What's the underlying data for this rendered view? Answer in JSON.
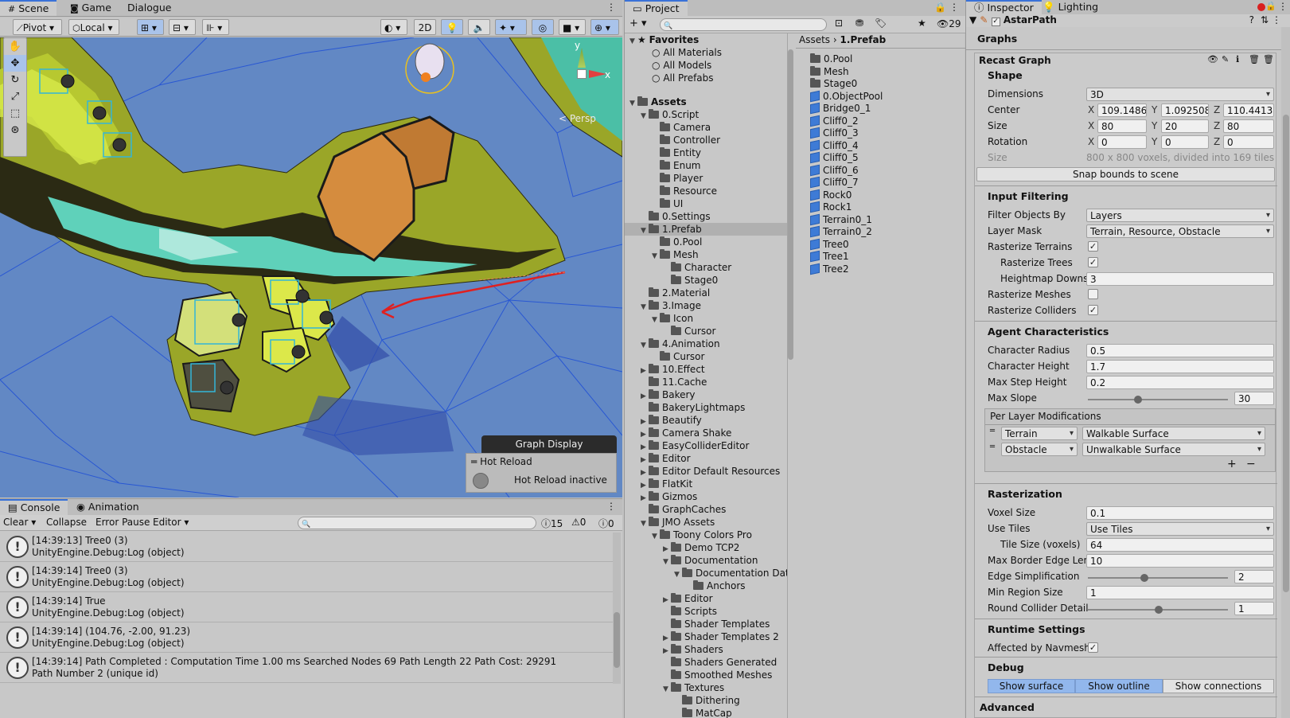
{
  "scene_tabs": [
    "Scene",
    "Game",
    "Dialogue"
  ],
  "scene_toolbar": {
    "pivot": "Pivot",
    "local": "Local",
    "mode2d": "2D"
  },
  "persp": "< Persp",
  "axis_labels": {
    "y": "y",
    "x": "x",
    "z": "z"
  },
  "overlay": {
    "graph_display": "Graph Display",
    "hot_reload": "Hot Reload",
    "hot_reload_status": "Hot Reload inactive"
  },
  "console": {
    "tabs": [
      "Console",
      "Animation"
    ],
    "clear": "Clear",
    "collapse": "Collapse",
    "error_pause": "Error Pause",
    "editor": "Editor",
    "count_log": "15",
    "count_warn": "0",
    "count_err": "0",
    "logs": [
      {
        "l1": "[14:39:13] Tree0 (3)",
        "l2": "UnityEngine.Debug:Log (object)"
      },
      {
        "l1": "[14:39:14] Tree0 (3)",
        "l2": "UnityEngine.Debug:Log (object)"
      },
      {
        "l1": "[14:39:14] True",
        "l2": "UnityEngine.Debug:Log (object)"
      },
      {
        "l1": "[14:39:14] (104.76, -2.00, 91.23)",
        "l2": "UnityEngine.Debug:Log (object)"
      },
      {
        "l1": "[14:39:14] Path Completed : Computation Time 1.00 ms Searched Nodes 69 Path Length 22 Path Cost: 29291",
        "l2": "Path Number 2 (unique id)"
      }
    ]
  },
  "project": {
    "tab": "Project",
    "hidden_count": "29",
    "favorites": "Favorites",
    "fav_items": [
      "All Materials",
      "All Models",
      "All Prefabs"
    ],
    "assets": "Assets",
    "tree": [
      {
        "d": 1,
        "a": "▼",
        "t": "0.Script"
      },
      {
        "d": 2,
        "a": "",
        "t": "Camera"
      },
      {
        "d": 2,
        "a": "",
        "t": "Controller"
      },
      {
        "d": 2,
        "a": "",
        "t": "Entity"
      },
      {
        "d": 2,
        "a": "",
        "t": "Enum"
      },
      {
        "d": 2,
        "a": "",
        "t": "Player"
      },
      {
        "d": 2,
        "a": "",
        "t": "Resource"
      },
      {
        "d": 2,
        "a": "",
        "t": "UI"
      },
      {
        "d": 1,
        "a": "",
        "t": "0.Settings"
      },
      {
        "d": 1,
        "a": "▼",
        "t": "1.Prefab",
        "sel": true
      },
      {
        "d": 2,
        "a": "",
        "t": "0.Pool"
      },
      {
        "d": 2,
        "a": "▼",
        "t": "Mesh"
      },
      {
        "d": 3,
        "a": "",
        "t": "Character"
      },
      {
        "d": 3,
        "a": "",
        "t": "Stage0"
      },
      {
        "d": 1,
        "a": "",
        "t": "2.Material"
      },
      {
        "d": 1,
        "a": "▼",
        "t": "3.Image"
      },
      {
        "d": 2,
        "a": "▼",
        "t": "Icon"
      },
      {
        "d": 3,
        "a": "",
        "t": "Cursor"
      },
      {
        "d": 1,
        "a": "▼",
        "t": "4.Animation"
      },
      {
        "d": 2,
        "a": "",
        "t": "Cursor"
      },
      {
        "d": 1,
        "a": "▶",
        "t": "10.Effect"
      },
      {
        "d": 1,
        "a": "",
        "t": "11.Cache"
      },
      {
        "d": 1,
        "a": "▶",
        "t": "Bakery"
      },
      {
        "d": 1,
        "a": "",
        "t": "BakeryLightmaps"
      },
      {
        "d": 1,
        "a": "▶",
        "t": "Beautify"
      },
      {
        "d": 1,
        "a": "▶",
        "t": "Camera Shake"
      },
      {
        "d": 1,
        "a": "▶",
        "t": "EasyColliderEditor"
      },
      {
        "d": 1,
        "a": "▶",
        "t": "Editor"
      },
      {
        "d": 1,
        "a": "▶",
        "t": "Editor Default Resources"
      },
      {
        "d": 1,
        "a": "▶",
        "t": "FlatKit"
      },
      {
        "d": 1,
        "a": "▶",
        "t": "Gizmos"
      },
      {
        "d": 1,
        "a": "",
        "t": "GraphCaches"
      },
      {
        "d": 1,
        "a": "▼",
        "t": "JMO Assets"
      },
      {
        "d": 2,
        "a": "▼",
        "t": "Toony Colors Pro"
      },
      {
        "d": 3,
        "a": "▶",
        "t": "Demo TCP2"
      },
      {
        "d": 3,
        "a": "▼",
        "t": "Documentation"
      },
      {
        "d": 4,
        "a": "▼",
        "t": "Documentation Dat"
      },
      {
        "d": 5,
        "a": "",
        "t": "Anchors"
      },
      {
        "d": 3,
        "a": "▶",
        "t": "Editor"
      },
      {
        "d": 3,
        "a": "",
        "t": "Scripts"
      },
      {
        "d": 3,
        "a": "",
        "t": "Shader Templates"
      },
      {
        "d": 3,
        "a": "▶",
        "t": "Shader Templates 2"
      },
      {
        "d": 3,
        "a": "▶",
        "t": "Shaders"
      },
      {
        "d": 3,
        "a": "",
        "t": "Shaders Generated"
      },
      {
        "d": 3,
        "a": "",
        "t": "Smoothed Meshes"
      },
      {
        "d": 3,
        "a": "▼",
        "t": "Textures"
      },
      {
        "d": 4,
        "a": "",
        "t": "Dithering"
      },
      {
        "d": 4,
        "a": "",
        "t": "MatCap"
      }
    ],
    "breadcrumb": [
      "Assets",
      "1.Prefab"
    ],
    "contents": [
      {
        "t": "0.Pool",
        "k": "f"
      },
      {
        "t": "Mesh",
        "k": "f"
      },
      {
        "t": "Stage0",
        "k": "f"
      },
      {
        "t": "0.ObjectPool",
        "k": "p"
      },
      {
        "t": "Bridge0_1",
        "k": "p"
      },
      {
        "t": "Cliff0_2",
        "k": "p"
      },
      {
        "t": "Cliff0_3",
        "k": "p"
      },
      {
        "t": "Cliff0_4",
        "k": "p"
      },
      {
        "t": "Cliff0_5",
        "k": "p"
      },
      {
        "t": "Cliff0_6",
        "k": "p"
      },
      {
        "t": "Cliff0_7",
        "k": "p"
      },
      {
        "t": "Rock0",
        "k": "p"
      },
      {
        "t": "Rock1",
        "k": "p"
      },
      {
        "t": "Terrain0_1",
        "k": "p"
      },
      {
        "t": "Terrain0_2",
        "k": "p"
      },
      {
        "t": "Tree0",
        "k": "p"
      },
      {
        "t": "Tree1",
        "k": "p"
      },
      {
        "t": "Tree2",
        "k": "p"
      }
    ]
  },
  "inspector": {
    "tabs": [
      "Inspector",
      "Lighting"
    ],
    "object": "AstarPath",
    "graphs": "Graphs",
    "graph_name": "Recast Graph",
    "shape": "Shape",
    "dimensions_label": "Dimensions",
    "dimensions": "3D",
    "center_label": "Center",
    "center": [
      "109.1486",
      "1.092508",
      "110.4413"
    ],
    "size_label": "Size",
    "size": [
      "80",
      "20",
      "80"
    ],
    "rotation_label": "Rotation",
    "rotation": [
      "0",
      "0",
      "0"
    ],
    "info_label": "Size",
    "info": "800 x 800 voxels, divided into 169 tiles",
    "snap": "Snap bounds to scene",
    "input_filtering": "Input Filtering",
    "filter_by_label": "Filter Objects By",
    "filter_by": "Layers",
    "layer_mask_label": "Layer Mask",
    "layer_mask": "Terrain, Resource, Obstacle",
    "rasterize_terrains": "Rasterize Terrains",
    "rasterize_trees": "Rasterize Trees",
    "heightmap_label": "Heightmap Downsa",
    "heightmap": "3",
    "rasterize_meshes": "Rasterize Meshes",
    "rasterize_colliders": "Rasterize Colliders",
    "agent": "Agent Characteristics",
    "radius_label": "Character Radius",
    "radius": "0.5",
    "height_label": "Character Height",
    "height": "1.7",
    "step_label": "Max Step Height",
    "step": "0.2",
    "slope_label": "Max Slope",
    "slope": "30",
    "per_layer": "Per Layer Modifications",
    "layer1": "Terrain",
    "mod1": "Walkable Surface",
    "layer2": "Obstacle",
    "mod2": "Unwalkable Surface",
    "rasterization": "Rasterization",
    "voxel_label": "Voxel Size",
    "voxel": "0.1",
    "tiles_label": "Use Tiles",
    "tiles": "Use Tiles",
    "tilesize_label": "Tile Size (voxels)",
    "tilesize": "64",
    "border_label": "Max Border Edge Leng",
    "border": "10",
    "simplify_label": "Edge Simplification",
    "simplify": "2",
    "region_label": "Min Region Size",
    "region": "1",
    "round_label": "Round Collider Detail",
    "round": "1",
    "runtime": "Runtime Settings",
    "affected": "Affected by Navmesh",
    "debug": "Debug",
    "show_surface": "Show surface",
    "show_outline": "Show outline",
    "show_connections": "Show connections",
    "advanced": "Advanced"
  }
}
